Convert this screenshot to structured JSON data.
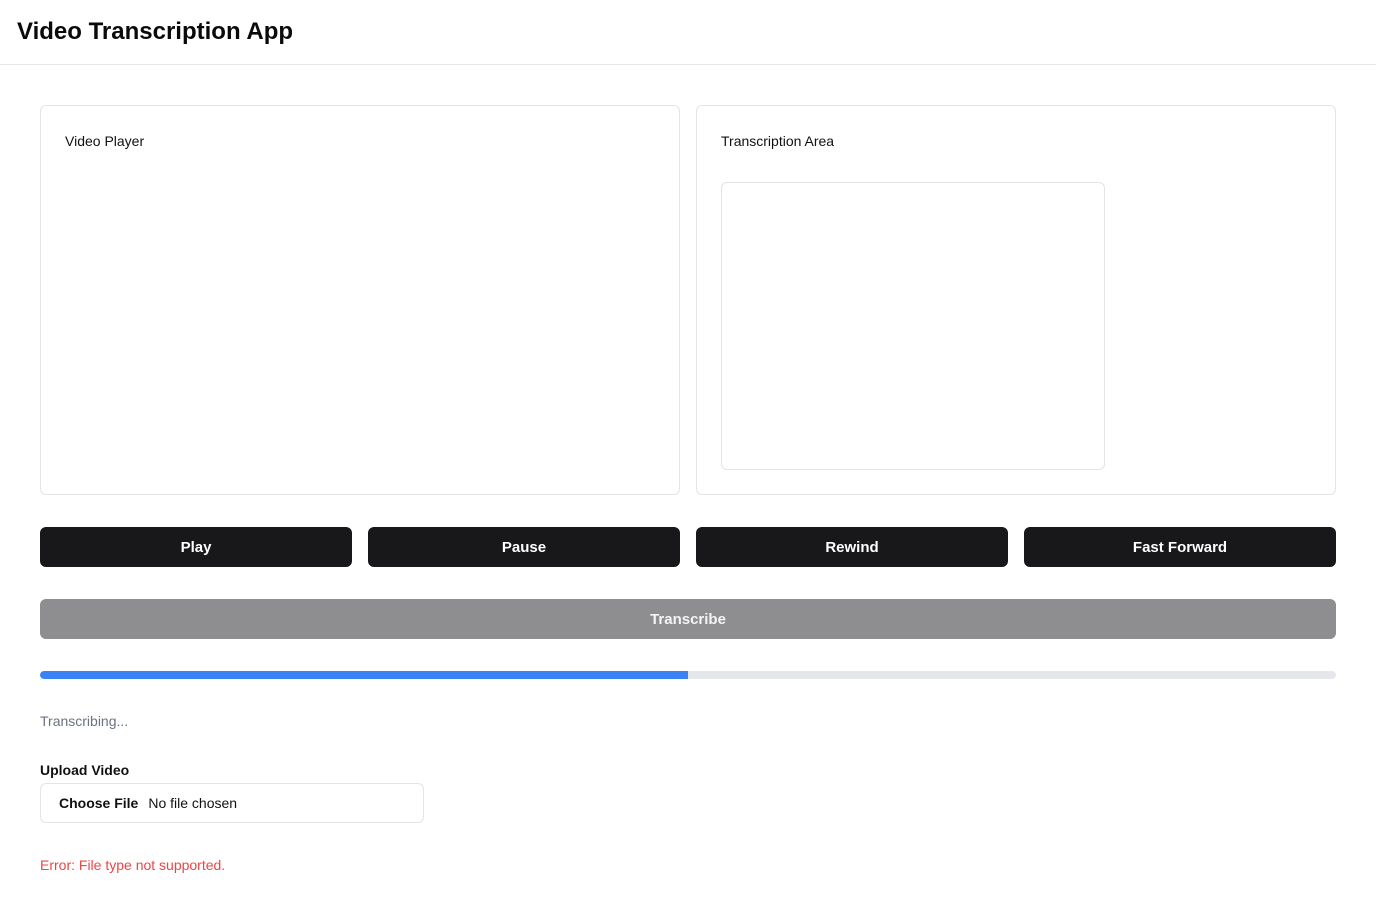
{
  "header": {
    "title": "Video Transcription App"
  },
  "video_card": {
    "title": "Video Player"
  },
  "transcription_card": {
    "title": "Transcription Area",
    "text_value": ""
  },
  "controls": {
    "play_label": "Play",
    "pause_label": "Pause",
    "rewind_label": "Rewind",
    "fast_forward_label": "Fast Forward"
  },
  "transcribe": {
    "label": "Transcribe",
    "disabled": true
  },
  "progress": {
    "percent": 50,
    "color": "#3b82f6",
    "track_color": "#e5e7eb"
  },
  "status": {
    "text": "Transcribing..."
  },
  "upload": {
    "label": "Upload Video",
    "button_label": "Choose File",
    "file_status": "No file chosen"
  },
  "error": {
    "text": "Error: File type not supported.",
    "color": "#ef4444"
  },
  "colors": {
    "button_dark": "#18181b",
    "button_disabled": "#8e8e90",
    "border": "#e4e4e7"
  }
}
